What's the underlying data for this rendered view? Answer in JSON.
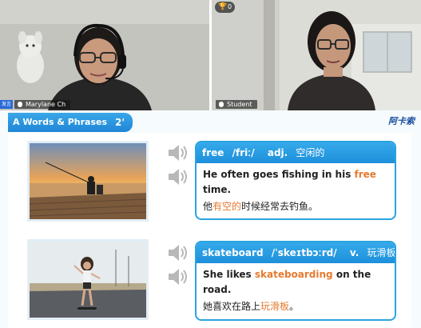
{
  "video": {
    "left_tile": {
      "name": "Marylane Ch",
      "host_badge": "发言"
    },
    "right_tile": {
      "name": "Student",
      "trophy_count": "0",
      "trophy_icon": "trophy-icon"
    }
  },
  "slide": {
    "header": {
      "title": "A Words & Phrases",
      "count": "2'"
    },
    "brand": "阿卡索",
    "colors": {
      "accent": "#1f8edb",
      "highlight": "#e57a2f"
    },
    "cards": [
      {
        "word": "free",
        "phonetic": "/friː/",
        "pos": "adj.",
        "meaning": "空闲的",
        "sentence_pre": "He often goes fishing in his ",
        "sentence_hl": "free",
        "sentence_post": " time.",
        "cn_pre": "他",
        "cn_hl": "有空的",
        "cn_post": "时候经常去钓鱼。"
      },
      {
        "word": "skateboard",
        "phonetic": "/ˈskeɪtbɔːrd/",
        "pos": "v.",
        "meaning": "玩滑板",
        "sentence_pre": "She likes ",
        "sentence_hl": "skateboarding",
        "sentence_post": " on the road.",
        "cn_pre": "她喜欢在路上",
        "cn_hl": "玩滑板",
        "cn_post": "。"
      }
    ]
  }
}
